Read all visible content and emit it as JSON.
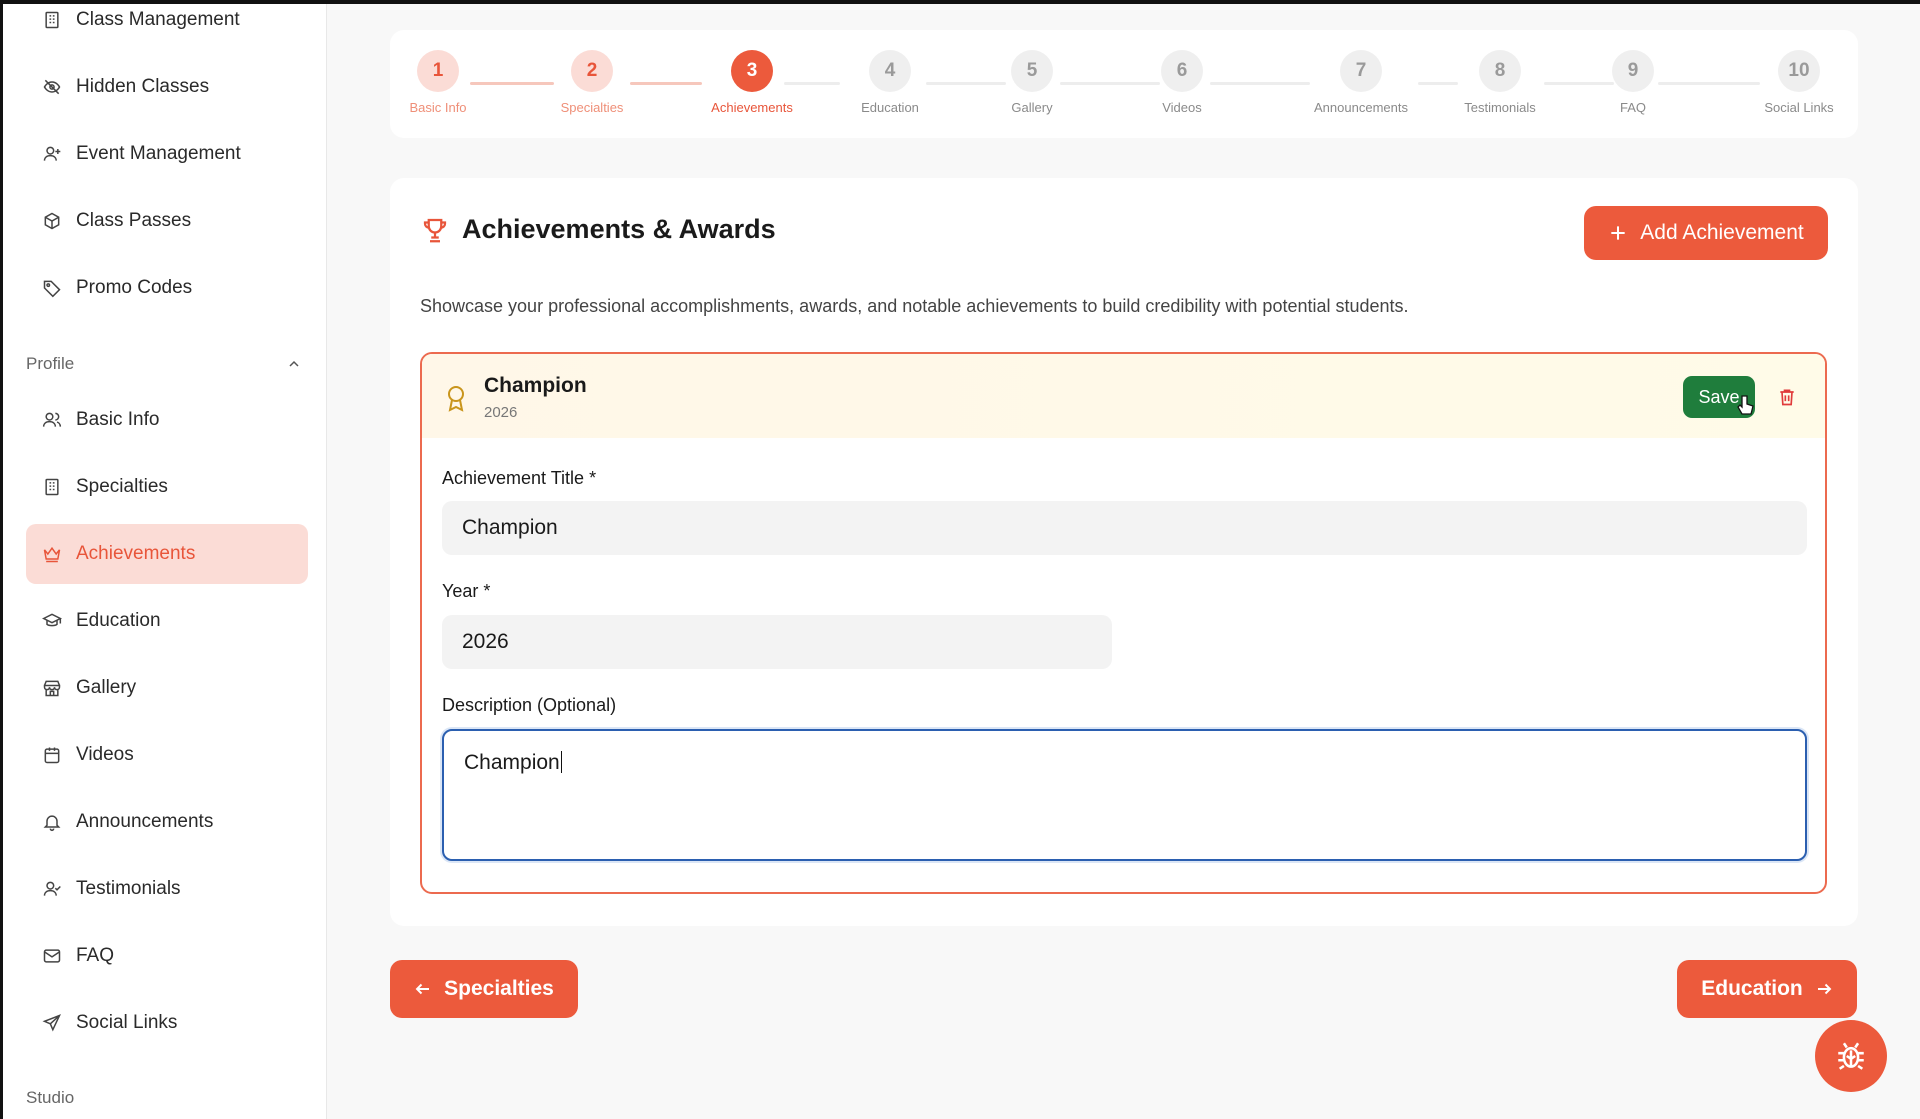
{
  "sidebar": {
    "items_top": [
      {
        "label": "Class Management",
        "icon": "building-icon"
      },
      {
        "label": "Hidden Classes",
        "icon": "eye-off-icon"
      },
      {
        "label": "Event Management",
        "icon": "user-plus-icon"
      },
      {
        "label": "Class Passes",
        "icon": "box-icon"
      },
      {
        "label": "Promo Codes",
        "icon": "tag-icon"
      }
    ],
    "profile_section": "Profile",
    "profile_items": [
      {
        "label": "Basic Info",
        "icon": "users-icon"
      },
      {
        "label": "Specialties",
        "icon": "building-icon"
      },
      {
        "label": "Achievements",
        "icon": "crown-icon"
      },
      {
        "label": "Education",
        "icon": "graduation-cap-icon"
      },
      {
        "label": "Gallery",
        "icon": "store-icon"
      },
      {
        "label": "Videos",
        "icon": "calendar-icon"
      },
      {
        "label": "Announcements",
        "icon": "bell-icon"
      },
      {
        "label": "Testimonials",
        "icon": "user-check-icon"
      },
      {
        "label": "FAQ",
        "icon": "mail-icon"
      },
      {
        "label": "Social Links",
        "icon": "send-icon"
      }
    ],
    "studio_section": "Studio"
  },
  "stepper": {
    "steps": [
      {
        "num": "1",
        "label": "Basic Info",
        "state": "done"
      },
      {
        "num": "2",
        "label": "Specialties",
        "state": "done"
      },
      {
        "num": "3",
        "label": "Achievements",
        "state": "current"
      },
      {
        "num": "4",
        "label": "Education",
        "state": "pending"
      },
      {
        "num": "5",
        "label": "Gallery",
        "state": "pending"
      },
      {
        "num": "6",
        "label": "Videos",
        "state": "pending"
      },
      {
        "num": "7",
        "label": "Announcements",
        "state": "pending"
      },
      {
        "num": "8",
        "label": "Testimonials",
        "state": "pending"
      },
      {
        "num": "9",
        "label": "FAQ",
        "state": "pending"
      },
      {
        "num": "10",
        "label": "Social Links",
        "state": "pending"
      }
    ]
  },
  "card": {
    "title": "Achievements & Awards",
    "add_button": "Add Achievement",
    "description": "Showcase your professional accomplishments, awards, and notable achievements to build credibility with potential students."
  },
  "achievement": {
    "name": "Champion",
    "year": "2026",
    "save_label": "Save",
    "title_label": "Achievement Title *",
    "title_value": "Champion",
    "year_label": "Year *",
    "year_value": "2026",
    "description_label": "Description (Optional)",
    "description_value": "Champion"
  },
  "footer_nav": {
    "prev_label": "Specialties",
    "next_label": "Education"
  },
  "colors": {
    "accent": "#ec5a3c",
    "accent_light": "#fbdcd6",
    "save_green": "#1f7d3c",
    "focus_blue": "#2b5fb0"
  }
}
